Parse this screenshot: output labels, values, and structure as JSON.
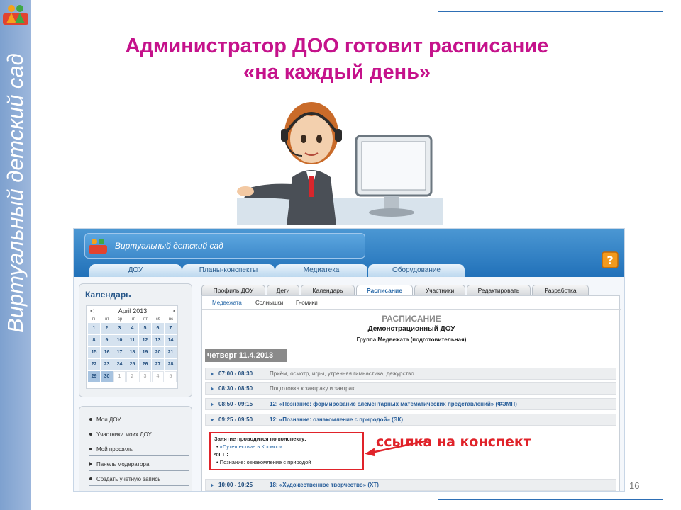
{
  "slide": {
    "side_text": "Виртуальный детский сад",
    "title_line1": "Администратор ДОО готовит расписание",
    "title_line2": "«на каждый день»",
    "page_number": "16"
  },
  "app": {
    "brand": "Виртуальный детский сад",
    "main_tabs": [
      "ДОУ",
      "Планы-конспекты",
      "Медиатека",
      "Оборудование"
    ],
    "calendar": {
      "title": "Календарь",
      "prev": "<",
      "month": "April 2013",
      "next": ">",
      "dows": [
        "пн",
        "вт",
        "ср",
        "чт",
        "пт",
        "сб",
        "вс"
      ],
      "days": [
        "1",
        "2",
        "3",
        "4",
        "5",
        "6",
        "7",
        "8",
        "9",
        "10",
        "11",
        "12",
        "13",
        "14",
        "15",
        "16",
        "17",
        "18",
        "19",
        "20",
        "21",
        "22",
        "23",
        "24",
        "25",
        "26",
        "27",
        "28",
        "29",
        "30",
        "1",
        "2",
        "3",
        "4",
        "5"
      ]
    },
    "menu": [
      "Мои ДОУ",
      "Участники моих ДОУ",
      "Мой профиль",
      "Панель модератора",
      "Создать учетную запись"
    ],
    "content_tabs": [
      "Профиль ДОУ",
      "Дети",
      "Календарь",
      "Расписание",
      "Участники",
      "Редактировать",
      "Разработка"
    ],
    "group_tabs": [
      "Медвежата",
      "Солнышки",
      "Гномики"
    ],
    "schedule": {
      "title": "РАСПИСАНИЕ",
      "org": "Демонстрационный ДОУ",
      "group": "Группа Медвежата (подготовительная)",
      "day": "четверг 11.4.2013",
      "rows": [
        {
          "time": "07:00 - 08:30",
          "desc": "Приём, осмотр, игры, утренняя гимнастика, дежурство"
        },
        {
          "time": "08:30 - 08:50",
          "desc": "Подготовка к завтраку и завтрак"
        },
        {
          "time": "08:50 - 09:15",
          "desc": "12: «Познание: формирование элементарных математических представлений» (ФЭМП)"
        },
        {
          "time": "09:25 - 09:50",
          "desc": "12: «Познание: ознакомление с природой» (ЭК)"
        },
        {
          "time": "10:00 - 10:25",
          "desc": "18: «Художественное творчество» (ХТ)"
        }
      ],
      "details": {
        "heading": "Занятие проводится по конспекту:",
        "link": "«Путешествие в Космос»",
        "fgt": "ФГТ :",
        "fgt_item": "Познание: ознакомление с природой"
      }
    }
  },
  "callout": "ссылка на конспект",
  "colors": {
    "title": "#c5128b",
    "callout": "#e0232a",
    "header": "#2171b9"
  }
}
